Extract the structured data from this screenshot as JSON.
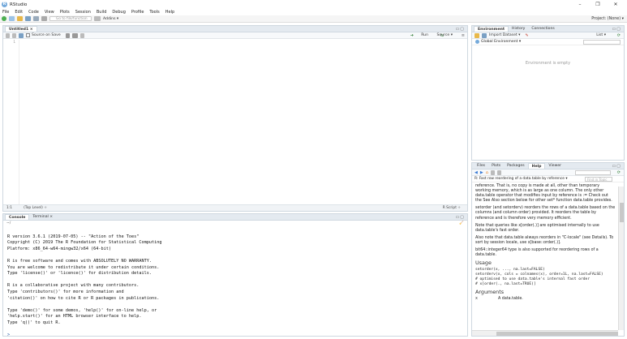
{
  "window": {
    "title": "RStudio",
    "icon_letter": "R",
    "minimize": "–",
    "maximize": "❐",
    "close": "✕"
  },
  "menu": [
    "File",
    "Edit",
    "Code",
    "View",
    "Plots",
    "Session",
    "Build",
    "Debug",
    "Profile",
    "Tools",
    "Help"
  ],
  "toolbar": {
    "goto_placeholder": "Go to file/function",
    "addins_label": "Addins ▾",
    "project_label": "Project: (None) ▾"
  },
  "editor": {
    "tab_label": "Untitled1 ×",
    "source_on_save": "Source on Save",
    "run_label": "Run",
    "source_label": "Source ▾",
    "line_number": "1",
    "status_position": "1:1",
    "status_scope": "(Top Level) ÷",
    "status_type": "R Script ÷"
  },
  "console": {
    "tabs": [
      "Console",
      "Terminal ×"
    ],
    "path": "~/",
    "lines": [
      "",
      "R version 3.6.1 (2019-07-05) -- \"Action of the Toes\"",
      "Copyright (C) 2019 The R Foundation for Statistical Computing",
      "Platform: x86_64-w64-mingw32/x64 (64-bit)",
      "",
      "R is free software and comes with ABSOLUTELY NO WARRANTY.",
      "You are welcome to redistribute it under certain conditions.",
      "Type 'license()' or 'licence()' for distribution details.",
      "",
      "R is a collaborative project with many contributors.",
      "Type 'contributors()' for more information and",
      "'citation()' on how to cite R or R packages in publications.",
      "",
      "Type 'demo()' for some demos, 'help()' for on-line help, or",
      "'help.start()' for an HTML browser interface to help.",
      "Type 'q()' to quit R.",
      "",
      ">"
    ]
  },
  "environment": {
    "tabs": [
      "Environment",
      "History",
      "Connections"
    ],
    "import_label": "Import Dataset ▾",
    "list_label": "List ▾",
    "scope_label": "Global Environment ▾",
    "empty_message": "Environment is empty"
  },
  "help": {
    "tabs": [
      "Files",
      "Plots",
      "Packages",
      "Help",
      "Viewer"
    ],
    "topic_label": "R: Fast row reordering of a data.table by reference ▾",
    "find_placeholder": "Find in Topic",
    "para1": "reference. That is, no copy is made at all, other than temporary working memory, which is as large as one column. The only other data.table operator that modifies input by reference is := Check out the See Also section below for other set* function data.table provides.",
    "para2": "setorder (and setorderv) reorders the rows of a data.table based on the columns (and column order) provided. It reorders the table by reference and is therefore very memory efficient.",
    "para3": "Note that queries like x[order(.)] are optimised internally to use data.table's fast order.",
    "para4": "Also note that data.table always reorders in \"C-locale\" (see Details). To sort by session locale, use x[base::order(.)].",
    "para5": "bit64::integer64 type is also supported for reordering rows of a data.table.",
    "usage_heading": "Usage",
    "usage_code": "setorder(x, ..., na.last=FALSE)\nsetorderv(x, cols = colnames(x), order=1L, na.last=FALSE)\n# optimised to use data.table's internal fast order\n# x[order(., na.last=TRUE)]",
    "arguments_heading": "Arguments",
    "arg_x": "x",
    "arg_x_desc": "A data.table."
  }
}
